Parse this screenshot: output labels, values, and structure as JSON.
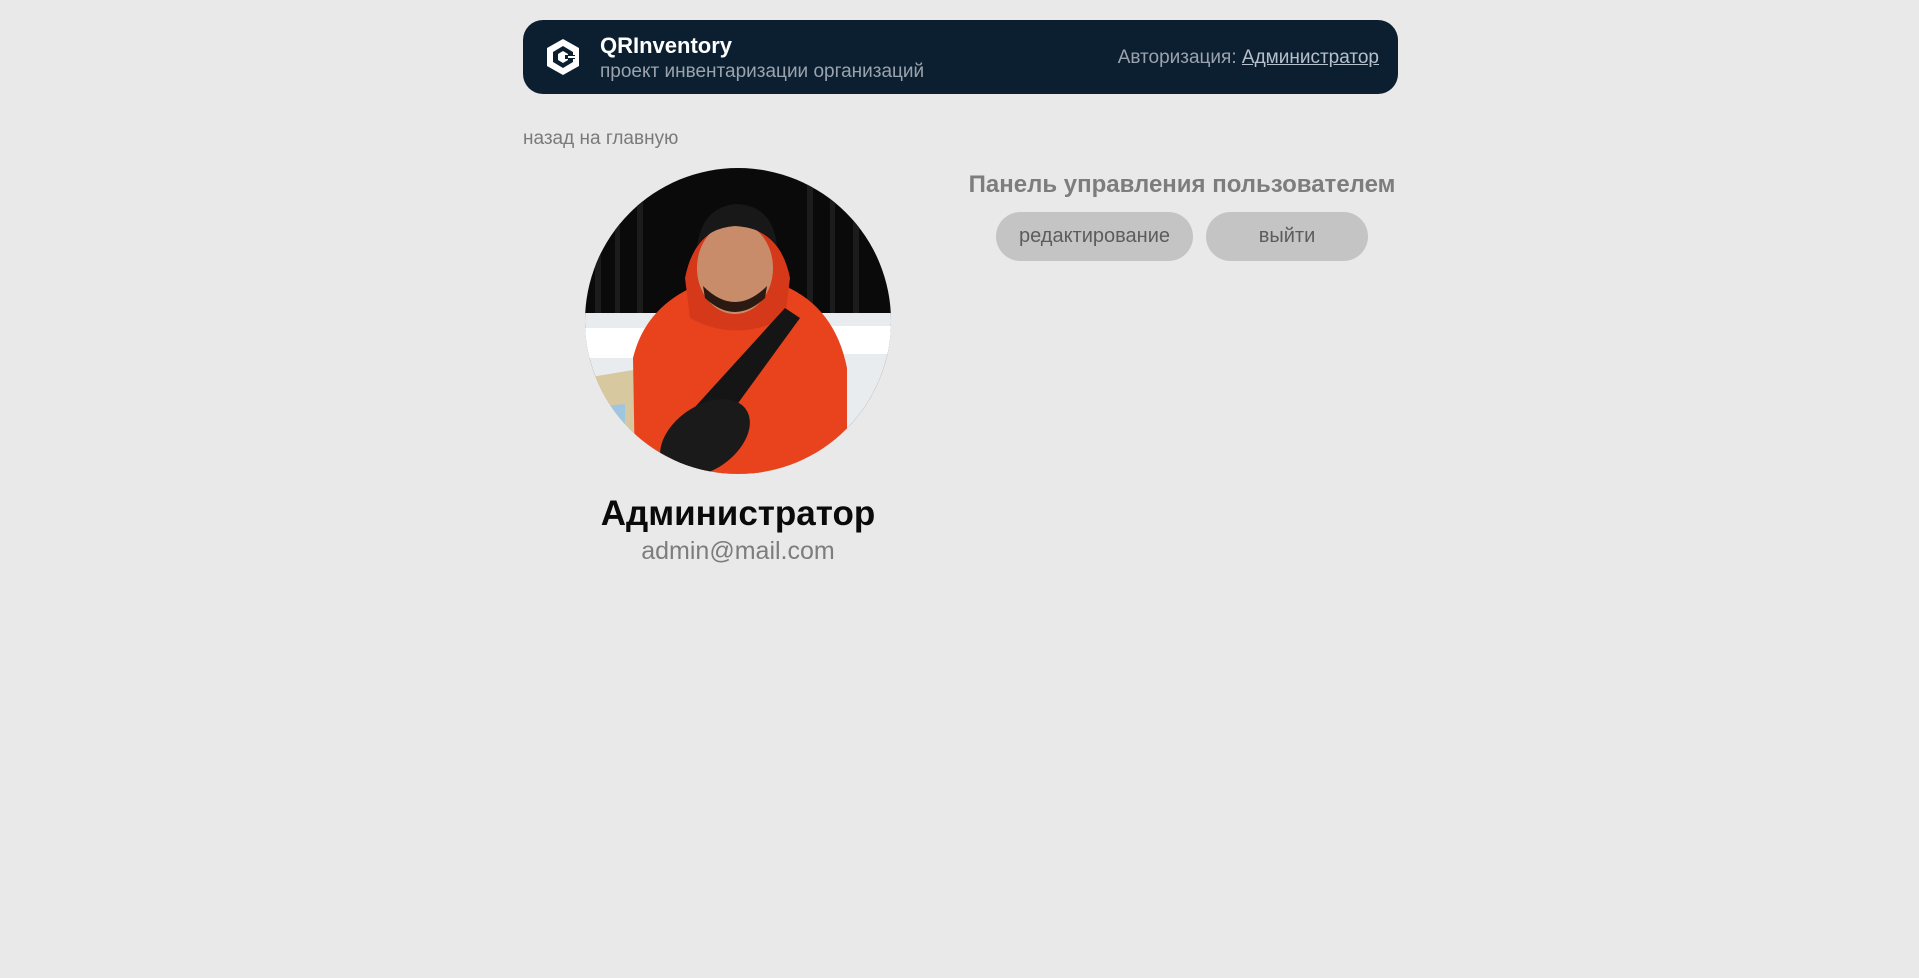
{
  "header": {
    "logo_icon": "qr-hexagon-logo-icon",
    "title": "QRInventory",
    "subtitle": "проект инвентаризации организаций",
    "auth_label": "Авторизация:",
    "auth_user": "Администратор"
  },
  "nav": {
    "back_label": "назад на главную"
  },
  "profile": {
    "avatar_icon": "user-photo-avatar",
    "name": "Администратор",
    "email": "admin@mail.com"
  },
  "panel": {
    "title": "Панель управления пользователем",
    "edit_label": "редактирование",
    "logout_label": "выйти"
  },
  "colors": {
    "page_bg": "#e9e9e9",
    "header_bg": "#0c1f30",
    "button_bg": "#c4c4c4",
    "hoodie": "#e8431c"
  }
}
